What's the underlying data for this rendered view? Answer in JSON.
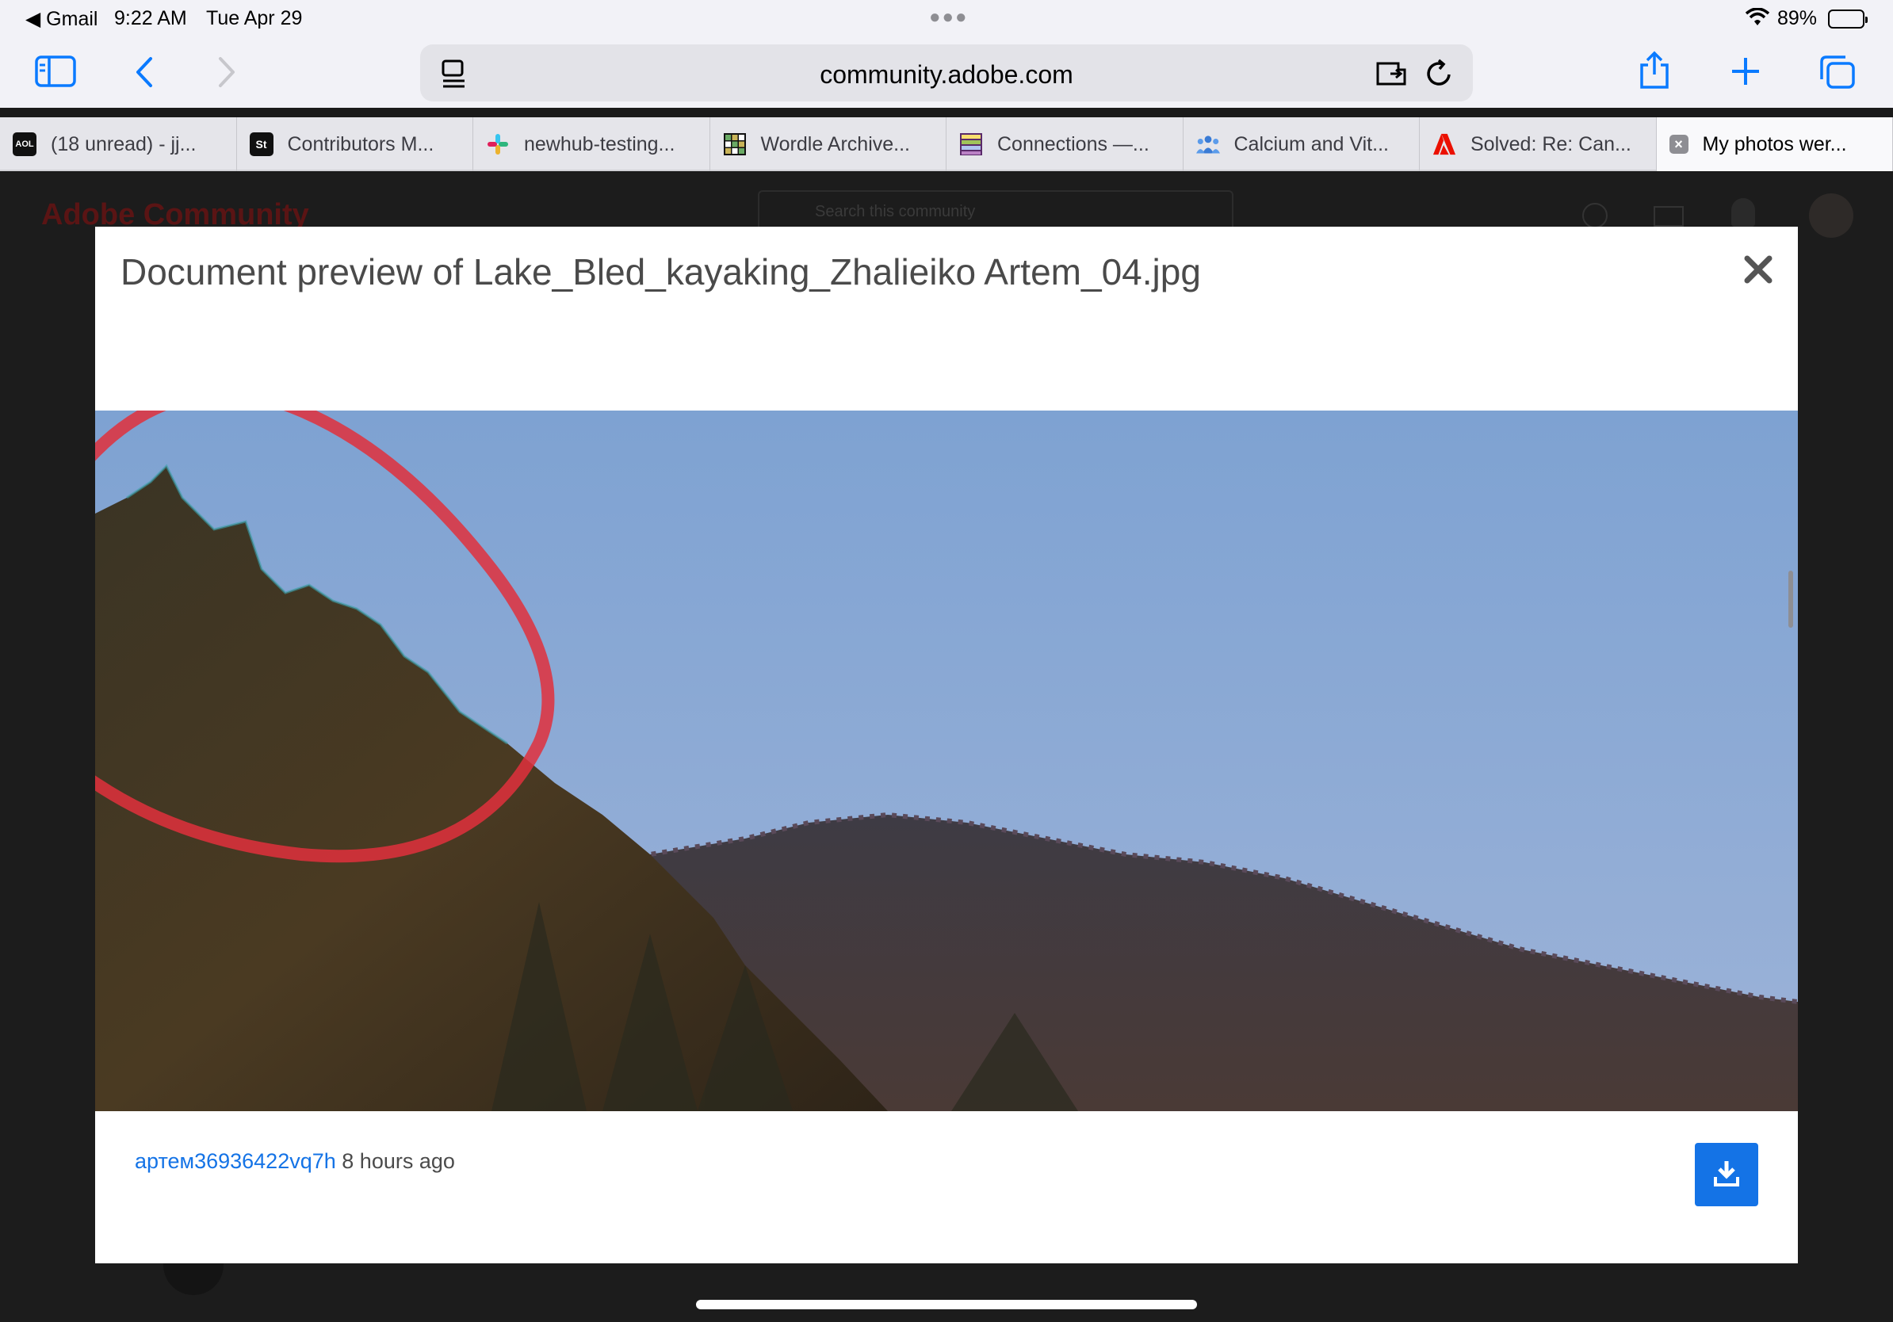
{
  "status_bar": {
    "back_app": "◀ Gmail",
    "time": "9:22 AM",
    "date": "Tue Apr 29",
    "battery": "89%",
    "battery_level": 0.89
  },
  "browser": {
    "url": "community.adobe.com",
    "tabs": [
      {
        "label": "(18 unread) - jj...",
        "icon": "aol-icon"
      },
      {
        "label": "Contributors M...",
        "icon": "adobe-stock-icon"
      },
      {
        "label": "newhub-testing...",
        "icon": "slack-icon"
      },
      {
        "label": "Wordle Archive...",
        "icon": "wordle-grid-icon"
      },
      {
        "label": "Connections —...",
        "icon": "connections-grid-icon"
      },
      {
        "label": "Calcium and Vit...",
        "icon": "people-icon"
      },
      {
        "label": "Solved: Re: Can...",
        "icon": "adobe-icon"
      },
      {
        "label": "My photos wer...",
        "icon": "close-tab-icon",
        "active": true
      }
    ]
  },
  "background_page": {
    "logo": "Adobe Community",
    "search_placeholder": "Search this community"
  },
  "modal": {
    "title": "Document preview of Lake_Bled_kayaking_Zhalieiko Artem_04.jpg",
    "uploader": "артем36936422vq7h",
    "time_ago": "8 hours ago"
  },
  "colors": {
    "accent": "#0a7aff",
    "adobe_blue": "#1473e6",
    "annotation_red": "#e0303c"
  }
}
